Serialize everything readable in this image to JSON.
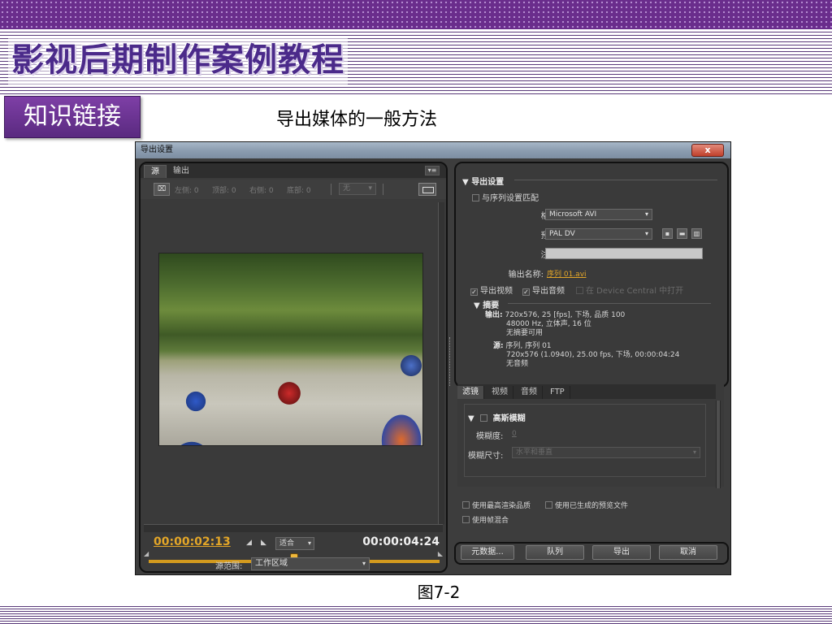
{
  "slide": {
    "title": "影视后期制作案例教程",
    "section_tag": "知识链接",
    "heading": "导出媒体的一般方法",
    "caption": "图7-2"
  },
  "dialog": {
    "title": "导出设置",
    "close_label": "x",
    "source_panel": {
      "tabs": [
        "源",
        "输出"
      ],
      "menu_icon": "panel-menu-icon",
      "crop_button": "⌧",
      "crop_fields": [
        "左侧: 0",
        "顶部: 0",
        "右侧: 0",
        "底部: 0"
      ],
      "crop_ratio": "无",
      "timecode_current": "00:00:02:13",
      "timecode_total": "00:00:04:24",
      "fit_select": "适合",
      "playhead_fraction": 0.5,
      "range_label": "源范围:",
      "range_value": "工作区域"
    },
    "export_settings": {
      "section_title": "导出设置",
      "match_sequence": "与序列设置匹配",
      "format_label": "格式:",
      "format_value": "Microsoft AVI",
      "preset_label": "预设:",
      "preset_value": "PAL DV",
      "comment_label": "注释:",
      "output_name_label": "输出名称:",
      "output_name_value": "序列 01.avi",
      "export_video": "导出视频",
      "export_audio": "导出音频",
      "device_central": "在 Device Central 中打开",
      "summary_title": "摘要",
      "summary_output_key": "输出:",
      "summary_output_lines": [
        "720x576, 25 [fps], 下场, 品质 100",
        "48000 Hz, 立体声, 16 位",
        "无摘要可用"
      ],
      "summary_source_key": "源:",
      "summary_source_lines": [
        "序列, 序列 01",
        "720x576 (1.0940), 25.00 fps, 下场, 00:00:04:24",
        "无音频"
      ]
    },
    "filter_tabs": [
      "滤镜",
      "视频",
      "音频",
      "FTP"
    ],
    "filter": {
      "name": "高斯模糊",
      "blurriness_label": "模糊度:",
      "blurriness_value": "0",
      "dimension_label": "模糊尺寸:",
      "dimension_value": "水平和垂直"
    },
    "options": {
      "max_render_quality": "使用最高渲染品质",
      "use_previews": "使用已生成的预览文件",
      "frame_blending": "使用帧混合"
    },
    "buttons": {
      "metadata": "元数据...",
      "queue": "队列",
      "export": "导出",
      "cancel": "取消"
    }
  }
}
